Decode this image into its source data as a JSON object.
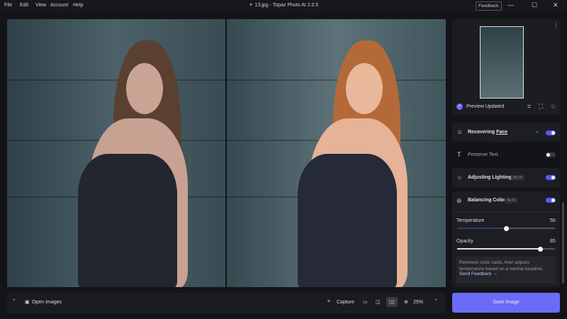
{
  "menu": [
    "File",
    "Edit",
    "View",
    "Account",
    "Help"
  ],
  "title": "13.jpg - Topaz Photo AI 2.0.5",
  "feedback_button": "Feedback",
  "window_controls": {
    "minimize": "—",
    "maximize": "☐",
    "close": "✕"
  },
  "preview": {
    "status": "Preview Updated"
  },
  "models": [
    {
      "label": "Recovering ",
      "label_link": "Face",
      "enabled": true,
      "beta": false
    },
    {
      "label": "Preserve Text",
      "enabled": false,
      "beta": false
    },
    {
      "label": "Adjusting Lighting",
      "enabled": true,
      "beta": true
    },
    {
      "label": "Balancing Color",
      "enabled": true,
      "beta": true
    }
  ],
  "beta_label": "BETA",
  "sliders": [
    {
      "label": "Temperature",
      "value": "50",
      "fraction": 0.5
    },
    {
      "label": "Opacity",
      "value": "85",
      "fraction": 0.85
    }
  ],
  "description": "Removes color casts, then adjusts temperature based on a neutral baseline.",
  "send_feedback": "Send Feedback →",
  "bottom": {
    "open_images": "Open Images",
    "capture": "Capture",
    "zoom": "25%"
  },
  "save_button": "Save Image",
  "colors": {
    "accent": "#6a6cf6"
  }
}
